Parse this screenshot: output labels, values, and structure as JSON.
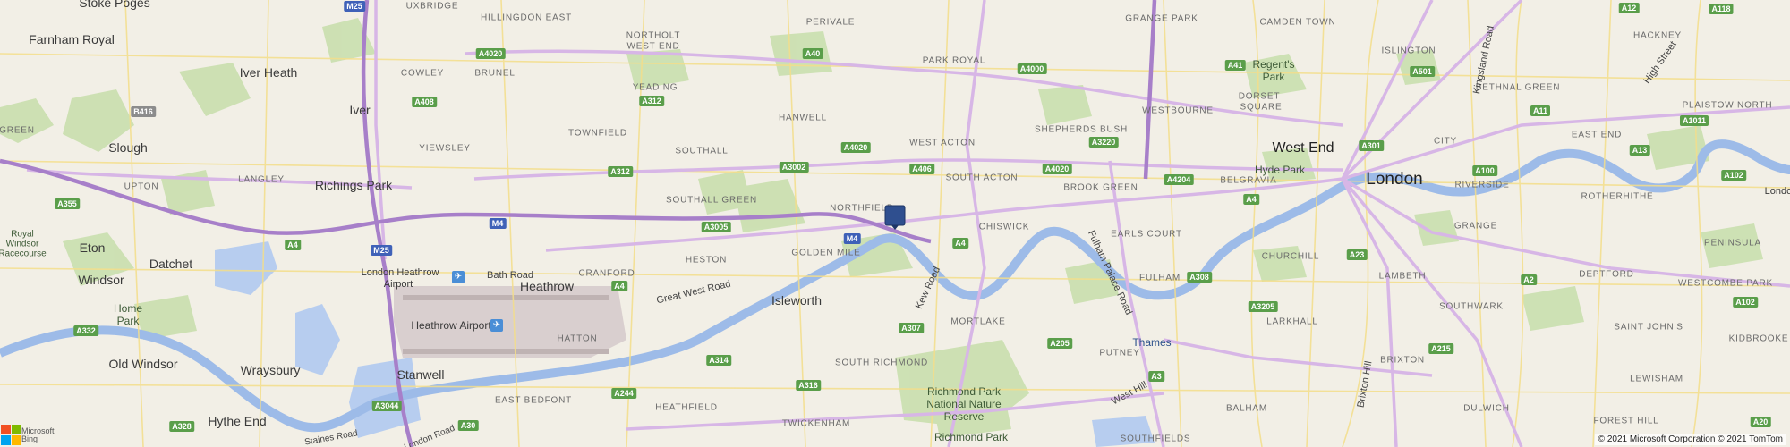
{
  "map": {
    "marker": {
      "name": "location-marker",
      "color": "#2f4f8f"
    },
    "copyright": "© 2021 Microsoft Corporation © 2021 TomTom",
    "logo": {
      "line1": "Microsoft",
      "line2": "Bing"
    },
    "colors": {
      "land": "#f2efe6",
      "park": "#c9dfae",
      "water": "#b7cdef",
      "motorway": "#a77fc9",
      "aroad": "#d7b6e6",
      "minor": "#f4de8a"
    },
    "labels": {
      "stoke_poges": "Stoke Poges",
      "farnham_royal": "Farnham Royal",
      "iver_heath": "Iver Heath",
      "iver": "Iver",
      "slough": "Slough",
      "richings_park": "Richings Park",
      "eton": "Eton",
      "windsor": "Windsor",
      "datchet": "Datchet",
      "old_windsor": "Old Windsor",
      "wraysbury": "Wraysbury",
      "stanwell": "Stanwell",
      "hythe_end": "Hythe End",
      "isleworth": "Isleworth",
      "west_end": "West End",
      "london": "London",
      "london_heathrow": "London Heathrow",
      "airport": "Airport",
      "heathrow": "Heathrow",
      "heathrow_airport": "Heathrow Airport",
      "uxbridge": "UXBRIDGE",
      "hillingdon_east": "HILLINGDON EAST",
      "northolt": "NORTHOLT",
      "west_end_small": "WEST END",
      "perivale": "PERIVALE",
      "grange_park": "GRANGE PARK",
      "camden_town": "CAMDEN TOWN",
      "hackney": "HACKNEY",
      "islington": "ISLINGTON",
      "cowley": "COWLEY",
      "brunel": "BRUNEL",
      "yeading": "YEADING",
      "hanwell": "HANWELL",
      "park_royal": "PARK ROYAL",
      "westbourne": "WESTBOURNE",
      "dorset": "DORSET",
      "square": "SQUARE",
      "bethnal_green": "BETHNAL GREEN",
      "plaistow_north": "PLAISTOW NORTH",
      "green": "GREEN",
      "townfield": "TOWNFIELD",
      "yiewsley": "YIEWSLEY",
      "southall": "SOUTHALL",
      "west_acton": "WEST ACTON",
      "shepherds_bush": "SHEPHERDS BUSH",
      "city": "CITY",
      "east_end": "EAST END",
      "upton": "UPTON",
      "langley": "LANGLEY",
      "southall_green": "SOUTHALL GREEN",
      "south_acton": "SOUTH ACTON",
      "brook_green": "BROOK GREEN",
      "belgravia": "BELGRAVIA",
      "riverside": "RIVERSIDE",
      "northfield": "NORTHFIELD",
      "chiswick": "CHISWICK",
      "rotherhithe": "ROTHERHITHE",
      "golden_mile": "GOLDEN MILE",
      "earls_court": "EARLS COURT",
      "grange": "GRANGE",
      "peninsula": "PENINSULA",
      "cranford": "CRANFORD",
      "heston": "HESTON",
      "fulham": "FULHAM",
      "churchill": "CHURCHILL",
      "lambeth": "LAMBETH",
      "deptford": "DEPTFORD",
      "westcombe_park": "WESTCOMBE PARK",
      "hatton": "HATTON",
      "mortlake": "MORTLAKE",
      "southwark": "SOUTHWARK",
      "larkhall": "LARKHALL",
      "saint_johns": "SAINT JOHN'S",
      "kidbrooke": "KIDBROOKE",
      "putney": "PUTNEY",
      "brixton": "BRIXTON",
      "south_richmond": "SOUTH RICHMOND",
      "lewisham": "LEWISHAM",
      "east_bedfont": "EAST BEDFONT",
      "heathfield": "HEATHFIELD",
      "twickenham": "TWICKENHAM",
      "balham": "BALHAM",
      "dulwich": "DULWICH",
      "forest_hill": "FOREST HILL",
      "southfields": "SOUTHFIELDS",
      "richmond_park_nnr": "Richmond Park National Nature Reserve",
      "richmond_park": "Richmond Park",
      "hyde_park": "Hyde Park",
      "regents_park": "Regent's Park",
      "home_park": "Home Park",
      "royal_windsor": "Royal Windsor Racecourse",
      "thames": "Thames",
      "bath_road": "Bath Road",
      "great_west_road": "Great West Road",
      "kew_road": "Kew Road",
      "fulham_palace_road": "Fulham Palace Road",
      "west_hill": "West Hill",
      "brixton_hill": "Brixton Hill",
      "kingsland_road": "Kingsland Road",
      "high_street": "High Street",
      "staines_road": "Staines Road",
      "london_road": "London Road",
      "london_edge": "London"
    },
    "shields": {
      "m25_top": "M25",
      "m25": "M25",
      "m4_a": "M4",
      "m4_b": "M4",
      "a4020_a": "A4020",
      "a4020_b": "A4020",
      "a4020_c": "A4020",
      "a40": "A40",
      "a4000": "A4000",
      "a41": "A41",
      "a501": "A501",
      "a12": "A12",
      "a118": "A118",
      "a408": "A408",
      "b416": "B416",
      "a312": "A312",
      "a312_b": "A312",
      "a3002": "A3002",
      "a406": "A406",
      "a3220": "A3220",
      "a4204": "A4204",
      "a301": "A301",
      "a11": "A11",
      "a1011": "A1011",
      "a13": "A13",
      "a355": "A355",
      "a100": "A100",
      "a102": "A102",
      "a4_a": "A4",
      "a4_b": "A4",
      "a4_c": "A4",
      "a4_d": "A4",
      "a3005": "A3005",
      "a308": "A308",
      "a23": "A23",
      "a2": "A2",
      "a3205": "A3205",
      "a307": "A307",
      "a205": "A205",
      "a3": "A3",
      "a332": "A332",
      "a314": "A314",
      "a316": "A316",
      "a215": "A215",
      "a102_b": "A102",
      "a3044": "A3044",
      "a244": "A244",
      "a328": "A328",
      "a30": "A30",
      "a20": "A20"
    }
  }
}
